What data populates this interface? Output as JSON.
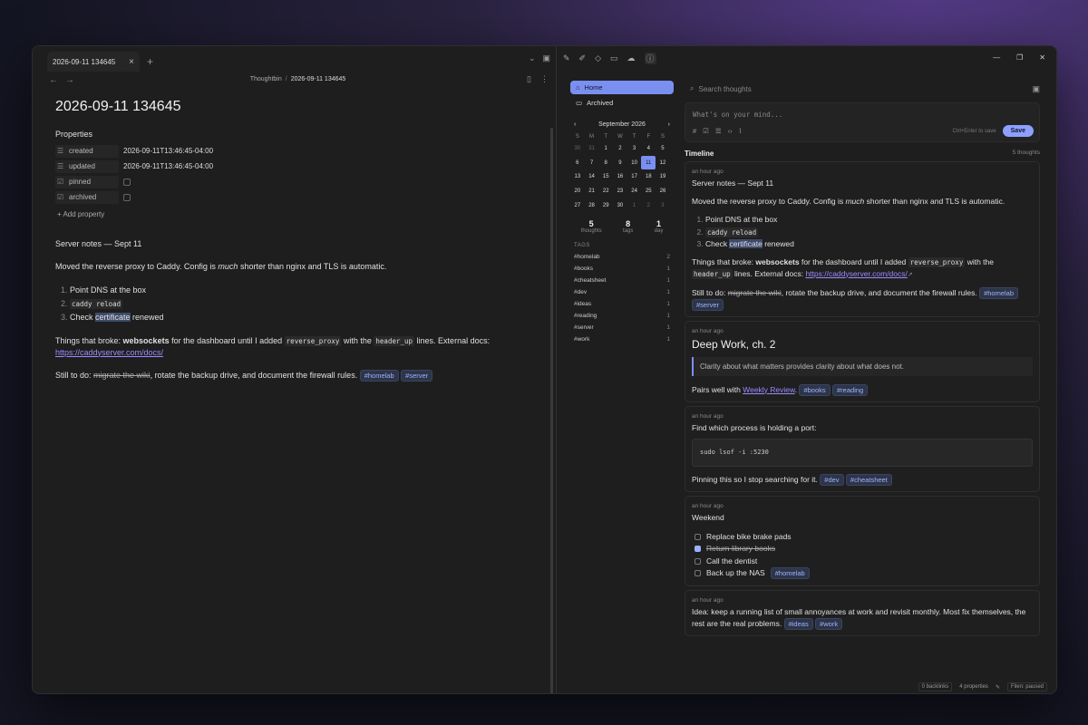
{
  "tab": {
    "title": "2026-09-11 134645",
    "close": "×",
    "new": "+"
  },
  "breadcrumb": {
    "root": "Thoughtbin",
    "sep": "/",
    "current": "2026-09-11 134645"
  },
  "note": {
    "title": "2026-09-11 134645",
    "properties_heading": "Properties",
    "props": [
      {
        "key": "created",
        "value": "2026-09-11T13:46:45-04:00"
      },
      {
        "key": "updated",
        "value": "2026-09-11T13:46:45-04:00"
      },
      {
        "key": "pinned"
      },
      {
        "key": "archived"
      }
    ],
    "add_property": "Add property",
    "heading": "Server notes — Sept 11",
    "p1a": "Moved the reverse proxy to Caddy. Config is ",
    "p1em": "much",
    "p1b": " shorter than nginx and TLS is automatic.",
    "steps": [
      "Point DNS at the box",
      "caddy reload",
      "Check ",
      "certificate",
      " renewed"
    ],
    "p2a": "Things that broke: ",
    "p2b": "websockets",
    "p2c": " for the dashboard until I added ",
    "p2code1": "reverse_proxy",
    "p2d": " with the ",
    "p2code2": "header_up",
    "p2e": " lines. External docs: ",
    "p2link": "https://caddyserver.com/docs/",
    "p3a": "Still to do: ",
    "p3strike": "migrate the wiki",
    "p3b": ", rotate the backup drive, and document the firewall rules. ",
    "tags": [
      "#homelab",
      "#server"
    ]
  },
  "sidebar": {
    "home": "Home",
    "archived": "Archived",
    "calendar": {
      "month": "September 2026",
      "dow": [
        "S",
        "M",
        "T",
        "W",
        "T",
        "F",
        "S"
      ],
      "days": [
        "30",
        "31",
        "1",
        "2",
        "3",
        "4",
        "5",
        "6",
        "7",
        "8",
        "9",
        "10",
        "11",
        "12",
        "13",
        "14",
        "15",
        "16",
        "17",
        "18",
        "19",
        "20",
        "21",
        "22",
        "23",
        "24",
        "25",
        "26",
        "27",
        "28",
        "29",
        "30",
        "1",
        "2",
        "3"
      ],
      "today": "11"
    },
    "stats": [
      {
        "n": "5",
        "l": "thoughts"
      },
      {
        "n": "8",
        "l": "tags"
      },
      {
        "n": "1",
        "l": "day"
      }
    ],
    "tags_heading": "TAGS",
    "tags": [
      {
        "name": "#homelab",
        "count": "2"
      },
      {
        "name": "#books",
        "count": "1"
      },
      {
        "name": "#cheatsheet",
        "count": "1"
      },
      {
        "name": "#dev",
        "count": "1"
      },
      {
        "name": "#ideas",
        "count": "1"
      },
      {
        "name": "#reading",
        "count": "1"
      },
      {
        "name": "#server",
        "count": "1"
      },
      {
        "name": "#work",
        "count": "1"
      }
    ]
  },
  "main": {
    "search_placeholder": "Search thoughts",
    "compose_placeholder": "What's on your mind...",
    "compose_hint": "Ctrl+Enter to save",
    "save": "Save",
    "timeline": "Timeline",
    "thought_count": "5 thoughts",
    "time": "an hour ago",
    "c1": {
      "title": "Server notes — Sept 11",
      "p1a": "Moved the reverse proxy to Caddy. Config is ",
      "p1em": "much",
      "p1b": " shorter than nginx and TLS is automatic.",
      "steps": [
        "Point DNS at the box",
        "caddy reload",
        "Check ",
        "certificate",
        " renewed"
      ],
      "p2a": "Things that broke: ",
      "p2b": "websockets",
      "p2c": " for the dashboard until I added ",
      "code1": "reverse_proxy",
      "p2d": " with the ",
      "code2": "header_up",
      "p2e": " lines. External docs: ",
      "link": "https://caddyserver.com/docs/",
      "p3a": "Still to do: ",
      "p3strike": "migrate the wiki",
      "p3b": ", rotate the backup drive, and document the firewall rules.",
      "tags": [
        "#homelab",
        "#server"
      ]
    },
    "c2": {
      "title": "Deep Work, ch. 2",
      "quote": "Clarity about what matters provides clarity about what does not.",
      "pa": "Pairs well with ",
      "link": "Weekly Review",
      "pb": ".",
      "tags": [
        "#books",
        "#reading"
      ]
    },
    "c3": {
      "text": "Find which process is holding a port:",
      "code": "sudo lsof -i :5230",
      "p": "Pinning this so I stop searching for it.",
      "tags": [
        "#dev",
        "#cheatsheet"
      ]
    },
    "c4": {
      "title": "Weekend",
      "items": [
        "Replace bike brake pads",
        "Return library books",
        "Call the dentist",
        "Back up the NAS"
      ],
      "tags": [
        "#homelab"
      ]
    },
    "c5": {
      "text": "Idea: keep a running list of small annoyances at work and revisit monthly. Most fix themselves, the rest are the real problems.",
      "tags": [
        "#ideas",
        "#work"
      ]
    }
  },
  "status": {
    "backlinks": "0 backlinks",
    "properties": "4 properties",
    "filen": "Filen: paused"
  }
}
